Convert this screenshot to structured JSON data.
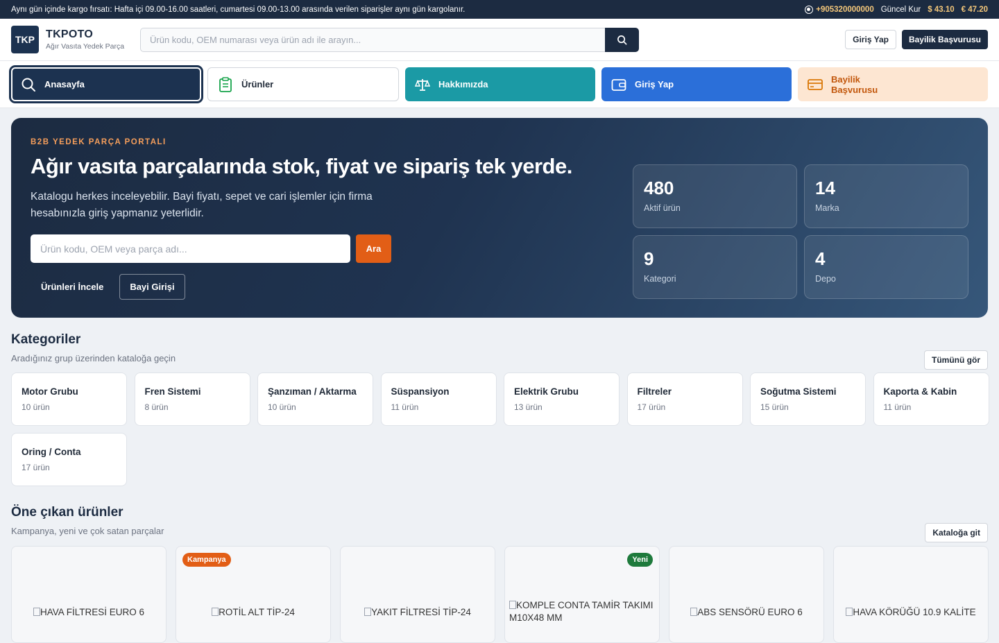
{
  "topbar": {
    "notice": "Aynı gün içinde kargo fırsatı: Hafta içi 09.00-16.00 saatleri, cumartesi 09.00-13.00 arasında verilen siparişler aynı gün kargolanır.",
    "phone": "+905320000000",
    "rate_label": "Güncel Kur",
    "usd": "$ 43.10",
    "eur": "€ 47.20"
  },
  "header": {
    "logo": "TKP",
    "brand": "TKPOTO",
    "tagline": "Ağır Vasıta Yedek Parça",
    "search_placeholder": "Ürün kodu, OEM numarası veya ürün adı ile arayın...",
    "login": "Giriş Yap",
    "dealer": "Bayilik Başvurusu"
  },
  "nav": {
    "home": "Anasayfa",
    "products": "Ürünler",
    "about": "Hakkımızda",
    "login": "Giriş Yap",
    "dealer_line1": "Bayilik",
    "dealer_line2": "Başvurusu",
    "colors": {
      "home": "#1c3250",
      "about": "#1b9aa5",
      "login": "#2b6fd9",
      "dealer": "#fde6d2"
    }
  },
  "hero": {
    "eyebrow": "B2B YEDEK PARÇA PORTALI",
    "title": "Ağır vasıta parçalarında stok, fiyat ve sipariş tek yerde.",
    "description": "Katalogu herkes inceleyebilir. Bayi fiyatı, sepet ve cari işlemler için firma hesabınızla giriş yapmanız yeterlidir.",
    "search_placeholder": "Ürün kodu, OEM veya parça adı...",
    "search_button": "Ara",
    "browse": "Ürünleri İncele",
    "dealer_login": "Bayi Girişi",
    "stats": [
      {
        "value": "480",
        "label": "Aktif ürün"
      },
      {
        "value": "14",
        "label": "Marka"
      },
      {
        "value": "9",
        "label": "Kategori"
      },
      {
        "value": "4",
        "label": "Depo"
      }
    ]
  },
  "categories": {
    "title": "Kategoriler",
    "subtitle": "Aradığınız grup üzerinden kataloğa geçin",
    "see_all": "Tümünü gör",
    "items": [
      {
        "name": "Motor Grubu",
        "count": "10 ürün"
      },
      {
        "name": "Fren Sistemi",
        "count": "8 ürün"
      },
      {
        "name": "Şanzıman / Aktarma",
        "count": "10 ürün"
      },
      {
        "name": "Süspansiyon",
        "count": "11 ürün"
      },
      {
        "name": "Elektrik Grubu",
        "count": "13 ürün"
      },
      {
        "name": "Filtreler",
        "count": "17 ürün"
      },
      {
        "name": "Soğutma Sistemi",
        "count": "15 ürün"
      },
      {
        "name": "Kaporta & Kabin",
        "count": "11 ürün"
      },
      {
        "name": "Oring / Conta",
        "count": "17 ürün"
      }
    ]
  },
  "featured": {
    "title": "Öne çıkan ürünler",
    "subtitle": "Kampanya, yeni ve çok satan parçalar",
    "catalog": "Kataloğa git",
    "items": [
      {
        "name": "HAVA FİLTRESİ EURO 6",
        "badge": ""
      },
      {
        "name": "ROTİL ALT TİP-24",
        "badge": "Kampanya"
      },
      {
        "name": "YAKIT FİLTRESİ TİP-24",
        "badge": ""
      },
      {
        "name": "KOMPLE CONTA TAMİR TAKIMI M10X48 MM",
        "badge": "Yeni"
      },
      {
        "name": "ABS SENSÖRÜ EURO 6",
        "badge": ""
      },
      {
        "name": "HAVA KÖRÜĞÜ 10.9 KALİTE",
        "badge": ""
      }
    ]
  }
}
